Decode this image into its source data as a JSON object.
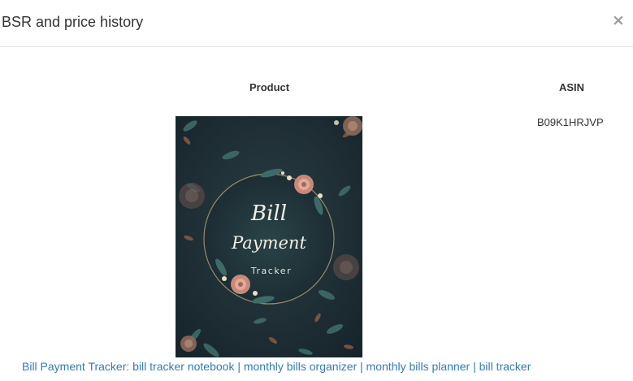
{
  "modal": {
    "title": "BSR and price history",
    "close_label": "×"
  },
  "table": {
    "headers": {
      "product": "Product",
      "asin": "ASIN"
    },
    "rows": [
      {
        "asin": "B09K1HRJVP",
        "title": "Bill Payment Tracker: bill tracker notebook | monthly bills organizer | monthly bills planner | bill tracker",
        "cover": {
          "line1": "Bill",
          "line2": "Payment",
          "line3": "Tracker",
          "background": "#1d2c31",
          "wreath_color": "#b9a27a",
          "flower_color": "#d99a8e",
          "leaf_color": "#3f6b67"
        }
      }
    ]
  },
  "colors": {
    "link": "#337ab7",
    "text": "#333333",
    "divider": "#e5e5e5"
  }
}
